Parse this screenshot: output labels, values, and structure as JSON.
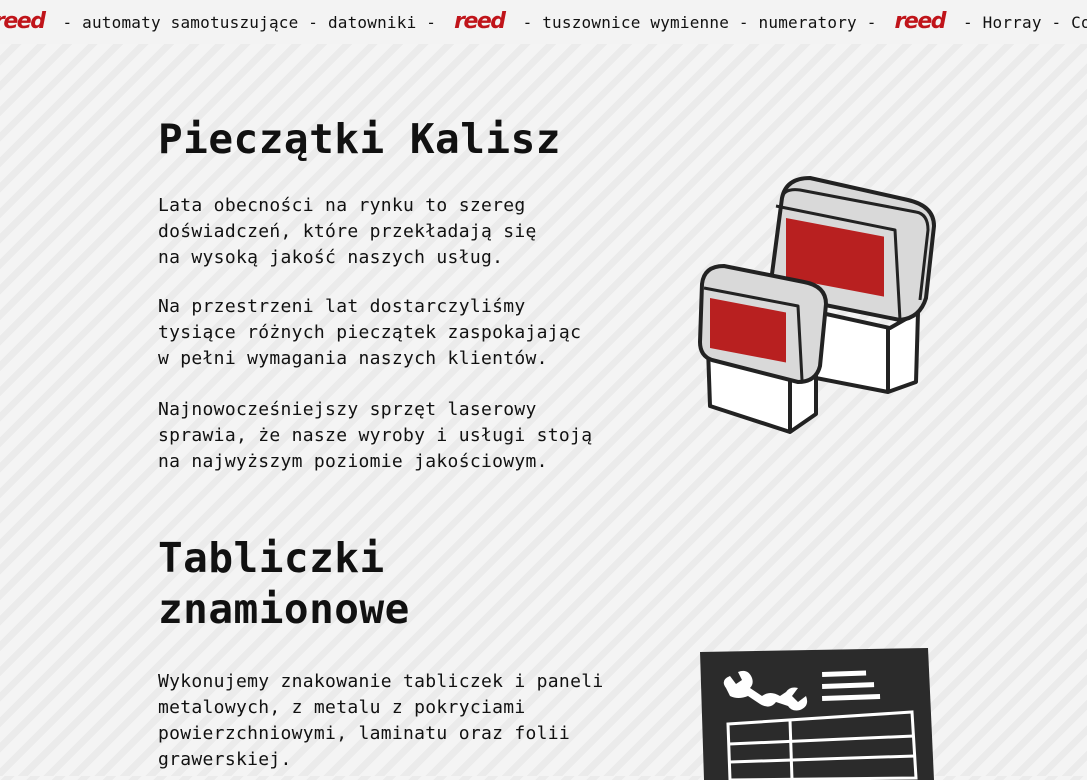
{
  "ticker": {
    "logo_text": "reed",
    "items": [
      "- automaty samotuszujące - datowniki -",
      "- tuszownice wymienne - numeratory -",
      "- Horray - Colop"
    ]
  },
  "section_stamps": {
    "title": "Pieczątki Kalisz",
    "paragraphs": [
      "Lata obecności na rynku to szereg\ndoświadczeń, które przekładają się\nna wysoką jakość naszych usług.",
      "Na przestrzeni lat dostarczyliśmy\ntysiące różnych pieczątek zaspokajając\nw pełni wymagania naszych klientów.",
      "Najnowocześniejszy sprzęt laserowy\nsprawia, że nasze wyroby i usługi stoją\nna najwyższym poziomie jakościowym."
    ],
    "illustration_icon": "stamps-icon"
  },
  "section_plates": {
    "title": "Tabliczki znamionowe",
    "paragraph": "Wykonujemy znakowanie tabliczek i paneli\nmetalowych, z metalu z pokryciami\npowierzchniowymi, laminatu oraz folii\ngrawerskiej.",
    "illustration_icon": "nameplate-icon"
  },
  "colors": {
    "accent_red": "#b82020",
    "brand_red": "#c0141a",
    "text": "#111111",
    "plate_dark": "#2b2b2b"
  }
}
